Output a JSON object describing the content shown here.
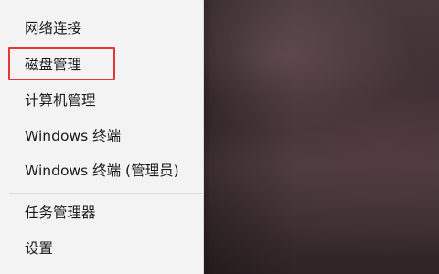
{
  "menu": {
    "items": [
      {
        "label": "网络连接"
      },
      {
        "label": "磁盘管理"
      },
      {
        "label": "计算机管理"
      },
      {
        "label": "Windows 终端"
      },
      {
        "label": "Windows 终端 (管理员)"
      },
      {
        "label": "任务管理器"
      },
      {
        "label": "设置"
      }
    ],
    "highlighted_item": "磁盘管理"
  },
  "colors": {
    "menu_background": "#f3f3f3",
    "highlight_border": "#e5343a",
    "text": "#1a1a1a"
  }
}
